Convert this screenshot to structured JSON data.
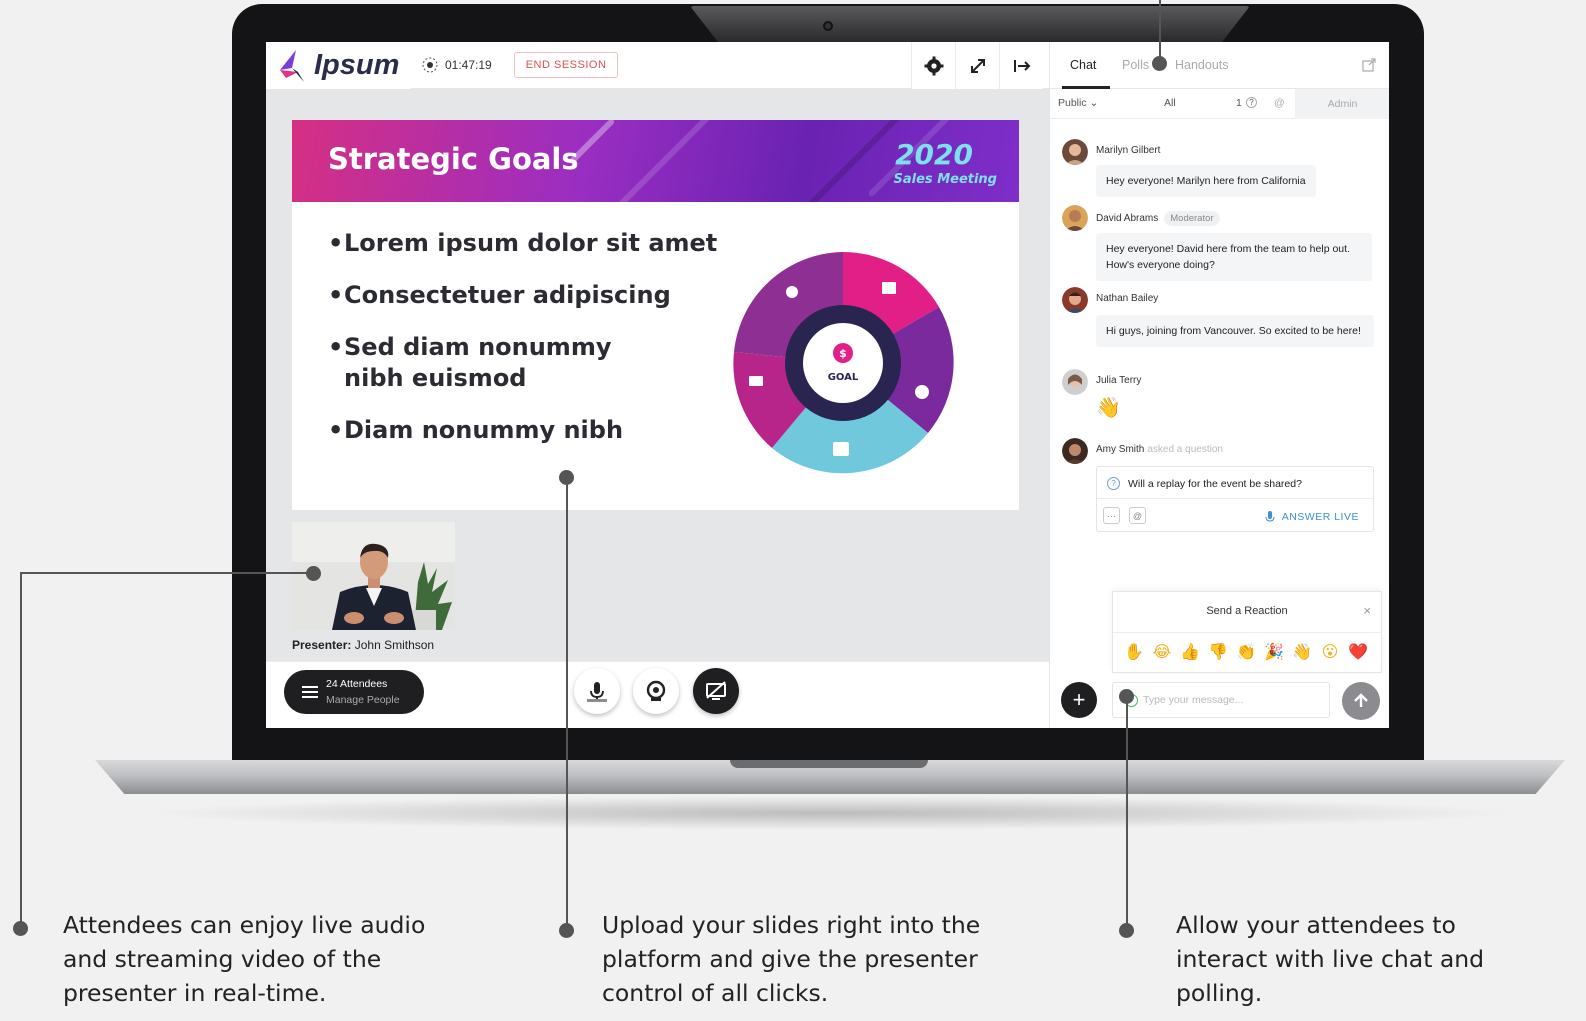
{
  "app": {
    "logo_text": "Ipsum"
  },
  "topbar": {
    "timer": "01:47:19",
    "end_session_label": "END SESSION",
    "icons": [
      "gear-icon",
      "expand-icon",
      "exit-icon"
    ]
  },
  "slide": {
    "title": "Strategic Goals",
    "year": "2020",
    "subtitle": "Sales Meeting",
    "bullets": [
      {
        "line1": "Lorem ipsum dolor sit amet",
        "line2": ""
      },
      {
        "line1": "Consectetuer adipiscing",
        "line2": ""
      },
      {
        "line1": "Sed diam nonummy",
        "line2": "nibh euismod"
      },
      {
        "line1": "Diam nonummy nibh",
        "line2": ""
      }
    ],
    "goal_label": "GOAL",
    "goal_symbol": "$"
  },
  "presenter": {
    "label": "Presenter:",
    "name": "John Smithson"
  },
  "bottom_bar": {
    "attendees_count": "24 Attendees",
    "manage_label": "Manage People"
  },
  "panel": {
    "tabs": [
      {
        "label": "Chat",
        "active": true
      },
      {
        "label": "Polls",
        "active": false
      },
      {
        "label": "Handouts",
        "active": false
      }
    ],
    "filters": {
      "public": "Public ⌄",
      "all": "All",
      "count": "1",
      "admin": "Admin"
    },
    "messages": [
      {
        "name": "Marilyn Gilbert",
        "badge": "",
        "text": "Hey everyone! Marilyn here from California"
      },
      {
        "name": "David Abrams",
        "badge": "Moderator",
        "text": "Hey everyone! David here from the team to help out. How's everyone doing?"
      },
      {
        "name": "Nathan Bailey",
        "badge": "",
        "text": "Hi guys, joining from Vancouver. So excited to be here!"
      },
      {
        "name": "Julia Terry",
        "badge": "",
        "text": "👋"
      },
      {
        "name": "Amy Smith",
        "badge": "",
        "asked": "asked a question",
        "text": "Will a replay for the event be shared?"
      }
    ],
    "answer_live_label": "ANSWER LIVE",
    "reaction": {
      "title": "Send a Reaction",
      "close": "×",
      "emojis": [
        "✋",
        "😂",
        "👍",
        "👎",
        "👏",
        "🎉",
        "👋",
        "😮",
        "❤️"
      ]
    },
    "input_placeholder": "Type your message..."
  },
  "captions": [
    {
      "line1": "Attendees can enjoy live audio",
      "line2": "and streaming video of the",
      "line3": "presenter in real-time."
    },
    {
      "line1": "Upload your slides right into the",
      "line2": "platform and give the presenter",
      "line3": "control of all clicks."
    },
    {
      "line1": "Allow your attendees to",
      "line2": "interact with live chat and",
      "line3": "polling."
    }
  ],
  "colors": {
    "brand_dark": "#1f1f22",
    "slide_header_start": "#d62f83",
    "slide_header_end": "#7f2ec9",
    "accent_teal": "#7ee0ef",
    "end_session_red": "#e05050",
    "answer_blue": "#3d8fd6"
  }
}
